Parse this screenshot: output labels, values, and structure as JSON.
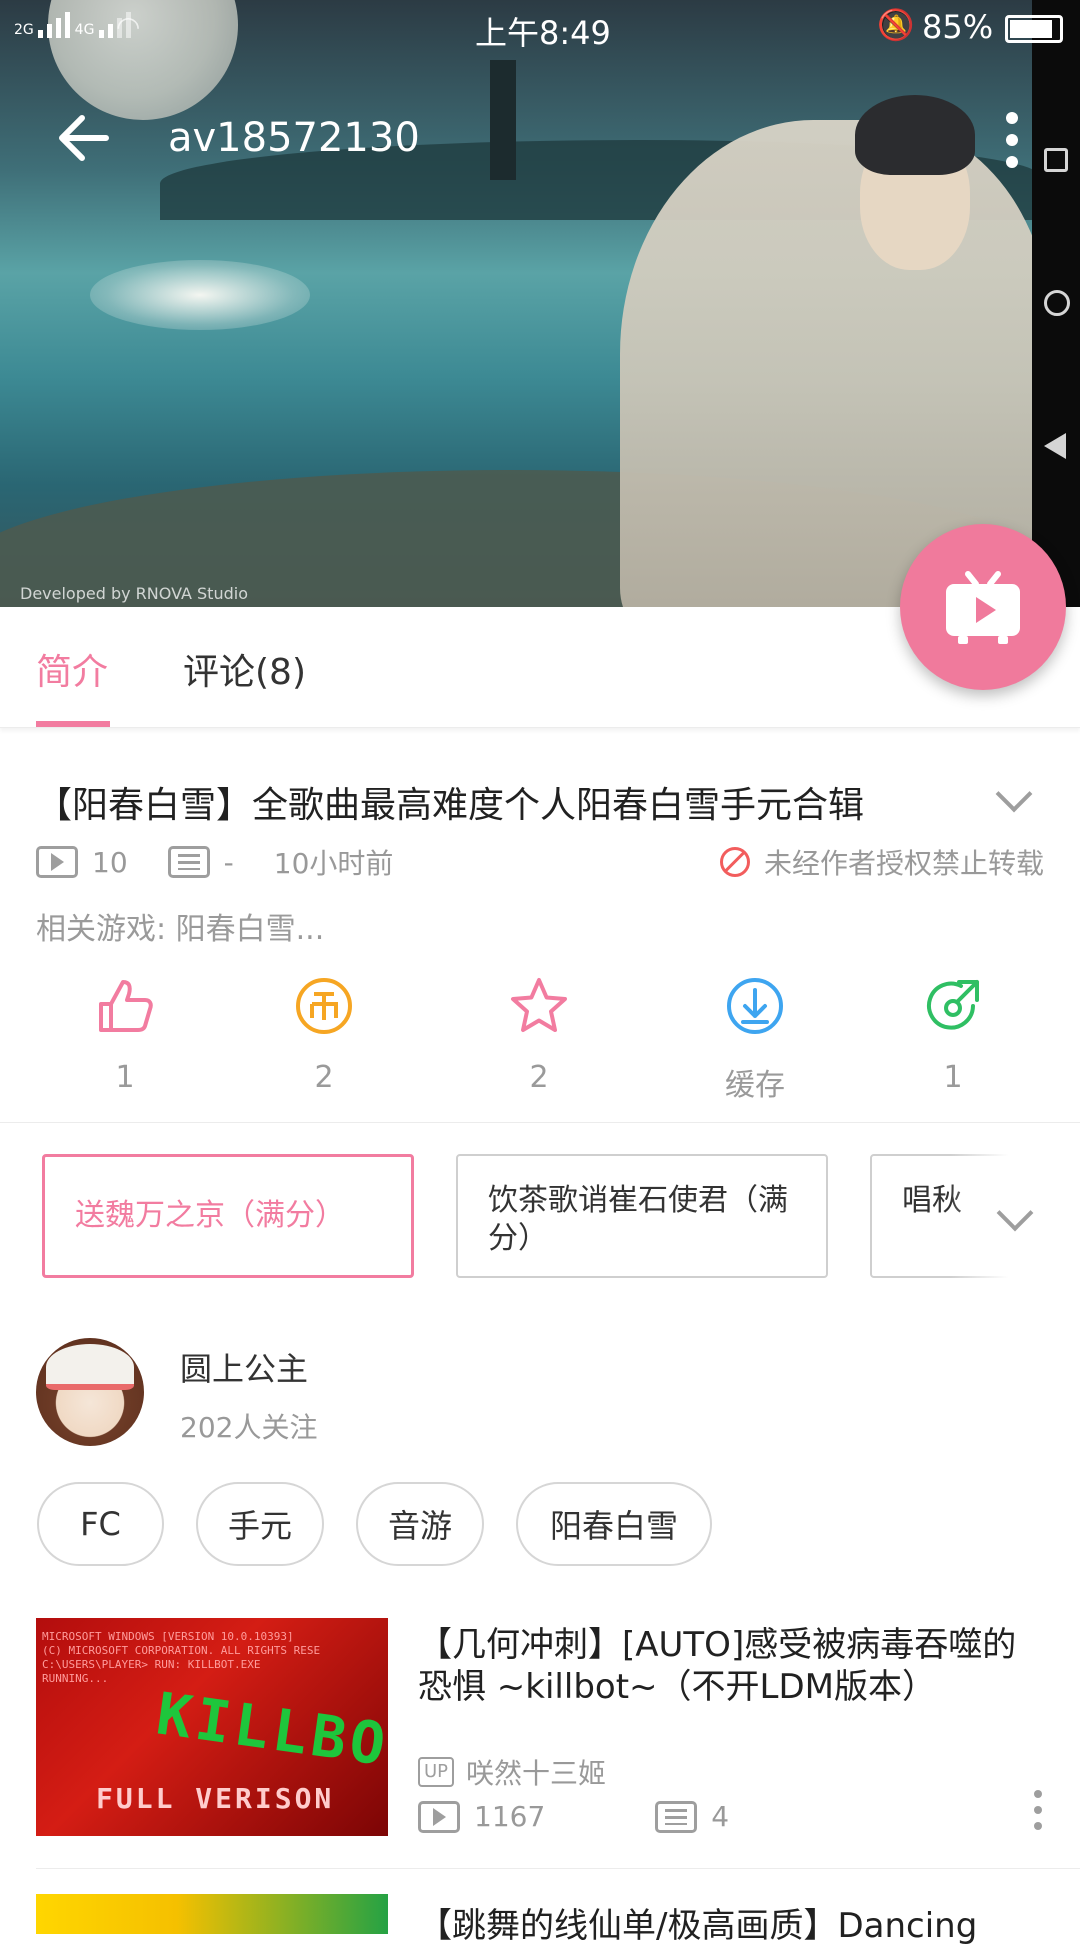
{
  "status_bar": {
    "signal1": "2G",
    "signal2": "4G",
    "time": "上午8:49",
    "battery": "85%"
  },
  "video": {
    "id_title": "av18572130",
    "cover_watermark": "Developed by RNOVA Studio"
  },
  "tabs": [
    {
      "label": "简介",
      "active": true
    },
    {
      "label": "评论(8)",
      "active": false
    }
  ],
  "info": {
    "title": "【阳春白雪】全歌曲最高难度个人阳春白雪手元合辑",
    "plays": "10",
    "danmaku": "-",
    "time_ago": "10小时前",
    "no_repost": "未经作者授权禁止转载",
    "related_game": "相关游戏: 阳春白雪..."
  },
  "actions": [
    {
      "name": "like",
      "icon": "thumb-up-icon",
      "label": "1",
      "color": "#f27ca0"
    },
    {
      "name": "coin",
      "icon": "coin-icon",
      "label": "2",
      "color": "#f6a623"
    },
    {
      "name": "favorite",
      "icon": "star-icon",
      "label": "2",
      "color": "#f27ca0"
    },
    {
      "name": "cache",
      "icon": "download-icon",
      "label": "缓存",
      "color": "#3ea5f0"
    },
    {
      "name": "share",
      "icon": "share-icon",
      "label": "1",
      "color": "#2fbf63"
    }
  ],
  "parts": [
    {
      "label": "送魏万之京（满分）",
      "active": true
    },
    {
      "label": "饮茶歌诮崔石使君（满分）",
      "active": false
    },
    {
      "label": "唱秋",
      "active": false
    }
  ],
  "uploader": {
    "name": "圆上公主",
    "followers": "202人关注"
  },
  "tags": [
    "FC",
    "手元",
    "音游",
    "阳春白雪"
  ],
  "recommended": [
    {
      "title": "【几何冲刺】[AUTO]感受被病毒吞噬的恐惧 ~killbot~（不开LDM版本）",
      "up_badge": "UP",
      "uploader": "咲然十三姬",
      "plays": "1167",
      "danmaku": "4",
      "thumb_text_top": "MICROSOFT WINDOWS [VERSION 10.0.10393]\n(C) MICROSOFT CORPORATION. ALL RIGHTS RESE\nC:\\USERS\\PLAYER> RUN: KILLBOT.EXE\nRUNNING...",
      "thumb_text_main": "KILLBOT",
      "thumb_text_bottom": "FULL VERISON"
    },
    {
      "title": "【跳舞的线仙单/极高画质】Dancing"
    }
  ],
  "colors": {
    "accent": "#f27ca0",
    "fab": "#f07a9c"
  }
}
